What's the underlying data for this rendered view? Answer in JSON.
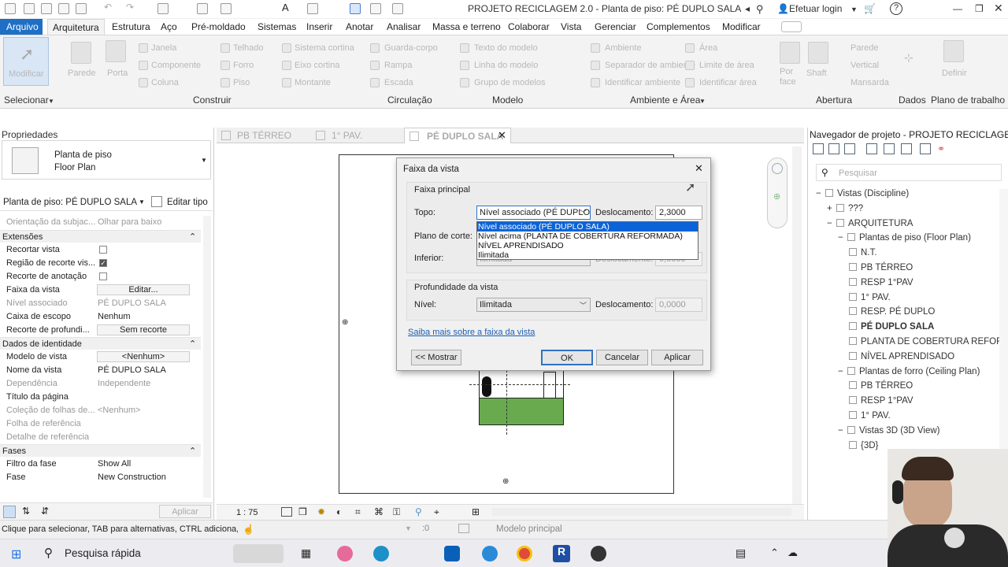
{
  "window": {
    "title": "PROJETO RECICLAGEM 2.0 - Planta de piso: PÉ DUPLO SALA",
    "login": "Efetuar login",
    "help": "?"
  },
  "menu": [
    "Arquivo",
    "Arquitetura",
    "Estrutura",
    "Aço",
    "Pré-moldado",
    "Sistemas",
    "Inserir",
    "Anotar",
    "Analisar",
    "Massa e terreno",
    "Colaborar",
    "Vista",
    "Gerenciar",
    "Complementos",
    "Modificar"
  ],
  "ribbon": {
    "modify": "Modificar",
    "wall": "Parede",
    "door": "Porta",
    "window": "Janela",
    "component": "Componente",
    "column": "Coluna",
    "roof": "Telhado",
    "ceiling": "Forro",
    "floor": "Piso",
    "curtain_system": "Sistema cortina",
    "curtain_grid": "Eixo cortina",
    "mullion": "Montante",
    "railing": "Guarda-corpo",
    "ramp": "Rampa",
    "stair": "Escada",
    "model_text": "Texto do modelo",
    "model_line": "Linha do modelo",
    "model_group": "Grupo de modelos",
    "room": "Ambiente",
    "room_separator": "Separador de ambiente",
    "tag_room": "Identificar ambiente",
    "area": "Área",
    "area_boundary": "Limite de área",
    "tag_area": "Identificar área",
    "by_face": "Por face",
    "shaft": "Shaft",
    "wall_op": "Parede",
    "vertical": "Vertical",
    "dormer": "Mansarda",
    "define": "Definir",
    "panels": {
      "select": "Selecionar",
      "build": "Construir",
      "circulation": "Circulação",
      "model": "Modelo",
      "room_area": "Ambiente e Área",
      "opening": "Abertura",
      "datum": "Dados",
      "work_plane": "Plano de trabalho"
    }
  },
  "properties": {
    "title": "Propriedades",
    "type_line1": "Planta de piso",
    "type_line2": "Floor Plan",
    "selector": "Planta de piso: PÉ DUPLO SALA",
    "edit_type": "Editar tipo",
    "rows_top": [
      {
        "k": "Orientação da subjac...",
        "v": "Olhar para baixo"
      }
    ],
    "sec_extents": "Extensões",
    "crop_view": "Recortar vista",
    "crop_visible": "Região de recorte vis...",
    "annotation_crop": "Recorte de anotação",
    "view_range": "Faixa da vista",
    "view_range_btn": "Editar...",
    "assoc_level": "Nível associado",
    "assoc_level_v": "PÉ DUPLO SALA",
    "scope_box": "Caixa de escopo",
    "scope_box_v": "Nenhum",
    "depth_clip": "Recorte de profundi...",
    "depth_clip_v": "Sem recorte",
    "sec_identity": "Dados de identidade",
    "view_template": "Modelo de vista",
    "view_template_v": "<Nenhum>",
    "view_name": "Nome da vista",
    "view_name_v": "PÉ DUPLO SALA",
    "dependency": "Dependência",
    "dependency_v": "Independente",
    "title_on_sheet": "Título da página",
    "sheet_collection": "Coleção de folhas de...",
    "sheet_collection_v": "<Nenhum>",
    "ref_sheet": "Folha de referência",
    "ref_detail": "Detalhe de referência",
    "sec_phases": "Fases",
    "phase_filter": "Filtro da fase",
    "phase_filter_v": "Show All",
    "phase": "Fase",
    "phase_v": "New Construction",
    "apply": "Aplicar"
  },
  "view_tabs": [
    "PB TÉRREO",
    "1° PAV.",
    "PÉ DUPLO SALA"
  ],
  "view_bar": {
    "scale": "1 : 75"
  },
  "dialog": {
    "title": "Faixa da vista",
    "primary": "Faixa principal",
    "top_label": "Topo:",
    "top_value": "Nível associado (PÉ DUPLO",
    "offset_label": "Deslocamento:",
    "top_offset": "2,3000",
    "cut_label": "Plano de corte:",
    "bottom_label": "Inferior:",
    "bottom_value": "Ilimitada",
    "bottom_offset_label": "Deslocamento:",
    "bottom_offset": "0,0000",
    "depth_title": "Profundidade da vista",
    "level_label": "Nível:",
    "level_value": "Ilimitada",
    "depth_offset": "0,0000",
    "link": "Saiba mais sobre a faixa da vista",
    "show_btn": "<< Mostrar",
    "ok": "OK",
    "cancel": "Cancelar",
    "apply": "Aplicar",
    "dropdown_options": [
      "Nível associado (PÉ DUPLO SALA)",
      "Nível acima (PLANTA DE COBERTURA REFORMADA)",
      "NÍVEL APRENDISADO",
      "Ilimitada"
    ]
  },
  "browser": {
    "title": "Navegador de projeto - PROJETO RECICLAGEM 2.0",
    "search_placeholder": "Pesquisar",
    "tree": [
      {
        "label": "Vistas (Discipline)",
        "indent": 0,
        "toggle": "−"
      },
      {
        "label": "???",
        "indent": 1,
        "toggle": "+"
      },
      {
        "label": "ARQUITETURA",
        "indent": 1,
        "toggle": "−"
      },
      {
        "label": "Plantas de piso (Floor Plan)",
        "indent": 2,
        "toggle": "−"
      },
      {
        "label": "N.T.",
        "indent": 3,
        "toggle": ""
      },
      {
        "label": "PB TÉRREO",
        "indent": 3,
        "toggle": ""
      },
      {
        "label": "RESP 1°PAV",
        "indent": 3,
        "toggle": ""
      },
      {
        "label": "1° PAV.",
        "indent": 3,
        "toggle": ""
      },
      {
        "label": "RESP. PÉ DUPLO",
        "indent": 3,
        "toggle": ""
      },
      {
        "label": "PÉ DUPLO SALA",
        "indent": 3,
        "toggle": "",
        "bold": true
      },
      {
        "label": "PLANTA DE COBERTURA REFOR",
        "indent": 3,
        "toggle": ""
      },
      {
        "label": "NÍVEL APRENDISADO",
        "indent": 3,
        "toggle": ""
      },
      {
        "label": "Plantas de forro (Ceiling Plan)",
        "indent": 2,
        "toggle": "−"
      },
      {
        "label": "PB TÉRREO",
        "indent": 3,
        "toggle": ""
      },
      {
        "label": "RESP 1°PAV",
        "indent": 3,
        "toggle": ""
      },
      {
        "label": "1° PAV.",
        "indent": 3,
        "toggle": ""
      },
      {
        "label": "Vistas 3D (3D View)",
        "indent": 2,
        "toggle": "−"
      },
      {
        "label": "{3D}",
        "indent": 3,
        "toggle": ""
      }
    ]
  },
  "status": {
    "hint": "Clique para selecionar, TAB para alternativas, CTRL adiciona, S",
    "zero": ":0",
    "model": "Modelo principal"
  },
  "taskbar": {
    "search": "Pesquisa rápida"
  }
}
